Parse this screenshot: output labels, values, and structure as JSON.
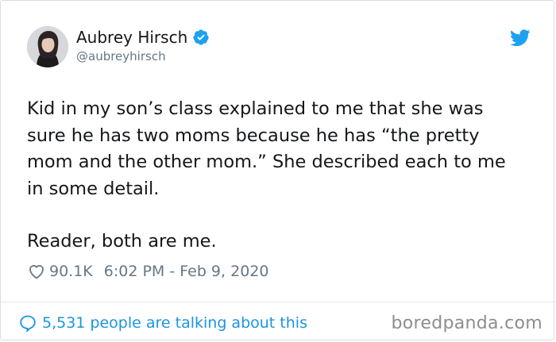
{
  "author": {
    "name": "Aubrey Hirsch",
    "handle": "@aubreyhirsch",
    "verified": true
  },
  "tweet": {
    "paragraphs": [
      "Kid in my son’s class explained to me that she was sure he has two moms because he has “the pretty mom and the other mom.” She described each to me in some detail.",
      "Reader, both are me."
    ]
  },
  "stats": {
    "likes": "90.1K",
    "timestamp": "6:02 PM - Feb 9, 2020"
  },
  "footer": {
    "conversation": "5,531 people are talking about this"
  },
  "watermark": "boredpanda.com",
  "icons": {
    "verified": "verified-badge-icon",
    "bird": "twitter-bird-icon",
    "like": "heart-icon",
    "reply": "speech-bubble-icon"
  },
  "colors": {
    "text": "#14171a",
    "muted": "#657786",
    "accent": "#1da1f2",
    "link": "#1b95e0",
    "watermark": "#8d8d8d"
  }
}
